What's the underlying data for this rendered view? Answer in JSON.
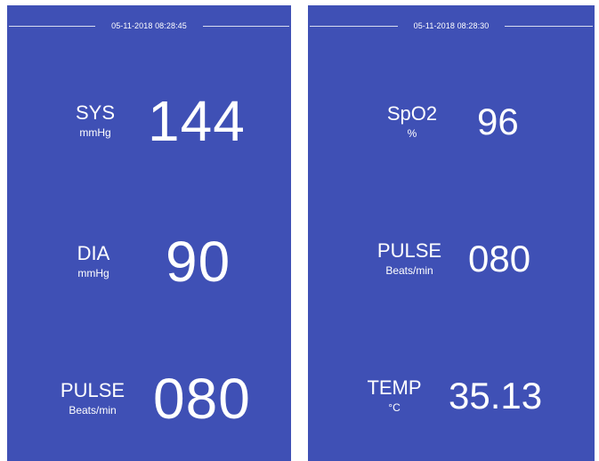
{
  "screens": [
    {
      "datetime": "05-11-2018 08:28:45",
      "readings": [
        {
          "name": "SYS",
          "unit": "mmHg",
          "value": "144"
        },
        {
          "name": "DIA",
          "unit": "mmHg",
          "value": "90"
        },
        {
          "name": "PULSE",
          "unit": "Beats/min",
          "value": "080"
        }
      ]
    },
    {
      "datetime": "05-11-2018 08:28:30",
      "readings": [
        {
          "name": "SpO2",
          "unit": "%",
          "value": "96"
        },
        {
          "name": "PULSE",
          "unit": "Beats/min",
          "value": "080"
        },
        {
          "name": "TEMP",
          "unit": "°C",
          "value": "35.13"
        }
      ]
    }
  ],
  "colors": {
    "screen_background": "#3f50b5",
    "text": "#ffffff",
    "page_background": "#ffffff"
  }
}
